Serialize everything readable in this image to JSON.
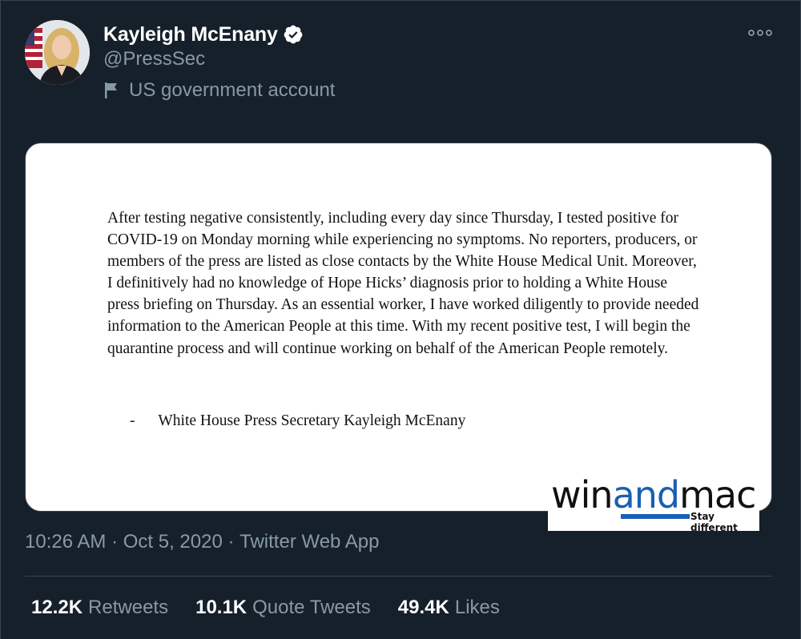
{
  "author": {
    "display_name": "Kayleigh McEnany",
    "handle": "@PressSec",
    "label": "US government account",
    "verified": true,
    "avatar_icon": "profile-photo"
  },
  "tweet_image": {
    "statement": "After testing negative consistently, including every day since Thursday, I tested positive for COVID-19 on Monday morning while experiencing no symptoms.  No reporters, producers, or members of the press are listed as close contacts by the White House Medical Unit. Moreover, I definitively had no knowledge of Hope Hicks’ diagnosis prior to holding a White House press briefing on Thursday. As an essential worker, I have worked diligently to provide needed information to the American People at this time. With my recent positive test, I will begin the quarantine process and will continue working on behalf of the American People remotely.",
    "signoff": "-      White House Press Secretary Kayleigh McEnany"
  },
  "watermark": {
    "part1": "win",
    "part2": "and",
    "part3": "mac",
    "tagline": "Stay different"
  },
  "meta": {
    "time": "10:26 AM",
    "separator": " · ",
    "date": "Oct 5, 2020",
    "app": "Twitter Web App"
  },
  "stats": {
    "retweets_count": "12.2K",
    "retweets_label": "Retweets",
    "quotes_count": "10.1K",
    "quotes_label": "Quote Tweets",
    "likes_count": "49.4K",
    "likes_label": "Likes"
  },
  "colors": {
    "background": "#15202b",
    "secondary_text": "#8899a6",
    "divider": "#38444d",
    "verified_badge": "#ffffff",
    "watermark_blue": "#1a5fb4"
  }
}
